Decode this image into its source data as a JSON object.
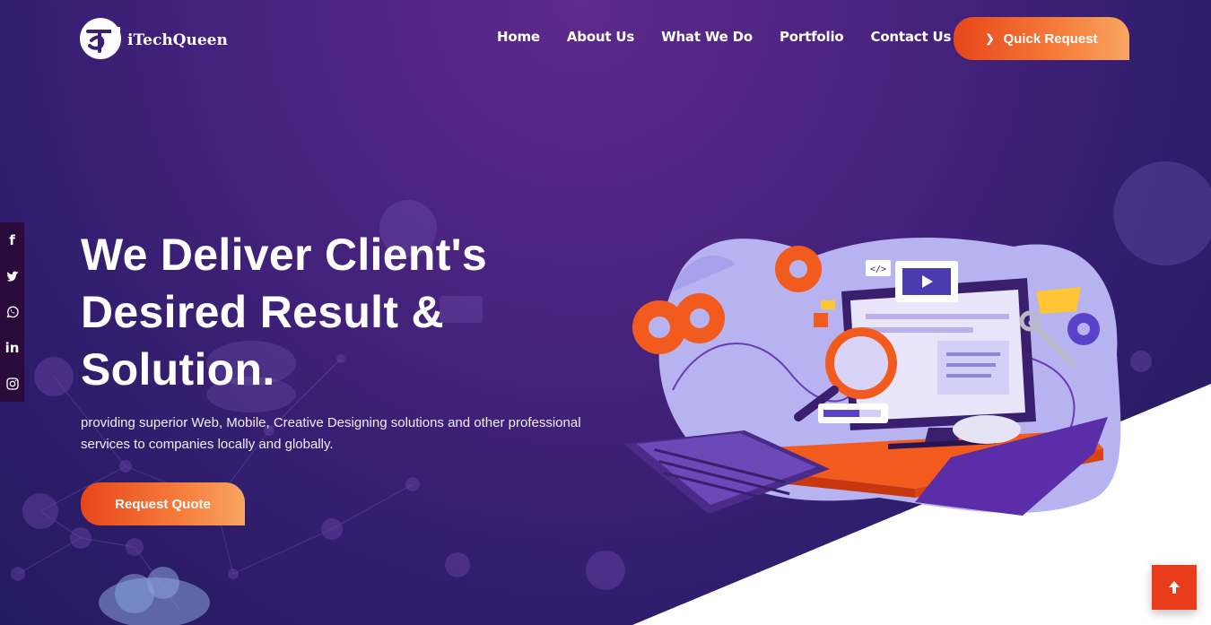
{
  "brand": {
    "name": "iTechQueen"
  },
  "nav": {
    "items": [
      {
        "label": "Home"
      },
      {
        "label": "About Us"
      },
      {
        "label": "What We Do"
      },
      {
        "label": "Portfolio"
      },
      {
        "label": "Contact Us"
      }
    ],
    "cta_label": "Quick Request"
  },
  "social": {
    "items": [
      {
        "icon": "facebook-icon",
        "glyph": "f"
      },
      {
        "icon": "twitter-icon"
      },
      {
        "icon": "whatsapp-icon"
      },
      {
        "icon": "linkedin-icon",
        "glyph": "in"
      },
      {
        "icon": "instagram-icon"
      }
    ]
  },
  "hero": {
    "title_line1": "We Deliver Client's",
    "title_line2": "Desired Result &",
    "title_line3": "Solution.",
    "subtitle": "providing superior Web, Mobile, Creative Designing solutions and other professional services to companies locally and globally.",
    "button_label": "Request Quote"
  },
  "colors": {
    "accent": "#e8461a",
    "accent_light": "#f9a562",
    "bg_dark": "#221a5e",
    "bg_purple": "#5e2a8c",
    "sidebar": "#2a0a3a"
  },
  "scroll_top": {
    "icon": "arrow-up-icon"
  }
}
